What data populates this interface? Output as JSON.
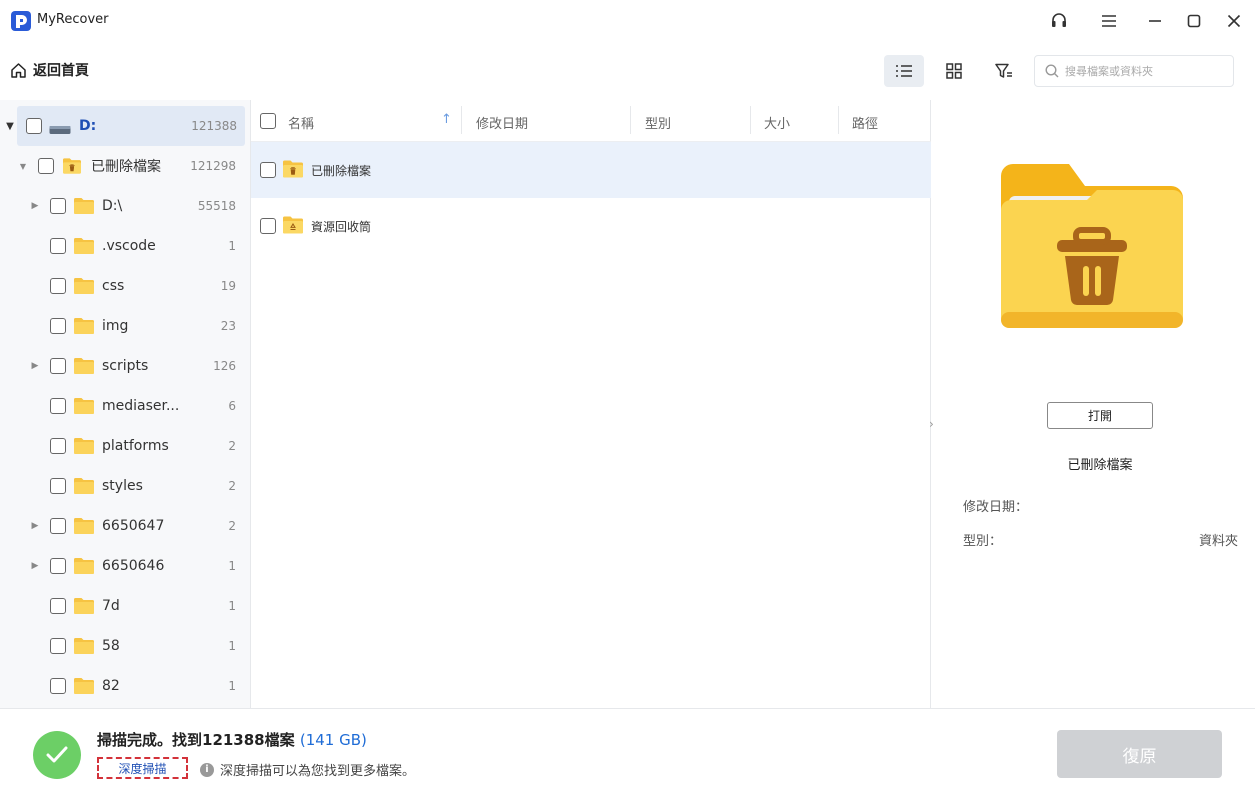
{
  "app": {
    "title": "MyRecover"
  },
  "toolbar": {
    "home_label": "返回首頁",
    "search_placeholder": "搜尋檔案或資料夾"
  },
  "tree": {
    "root": {
      "label": "D:",
      "count": "121388"
    },
    "deleted": {
      "label": "已刪除檔案",
      "count": "121298"
    },
    "items": [
      {
        "label": "D:\\",
        "count": "55518",
        "expandable": true
      },
      {
        "label": ".vscode",
        "count": "1",
        "expandable": false
      },
      {
        "label": "css",
        "count": "19",
        "expandable": false
      },
      {
        "label": "img",
        "count": "23",
        "expandable": false
      },
      {
        "label": "scripts",
        "count": "126",
        "expandable": true
      },
      {
        "label": "mediaser...",
        "count": "6",
        "expandable": false
      },
      {
        "label": "platforms",
        "count": "2",
        "expandable": false
      },
      {
        "label": "styles",
        "count": "2",
        "expandable": false
      },
      {
        "label": "6650647",
        "count": "2",
        "expandable": true
      },
      {
        "label": "6650646",
        "count": "1",
        "expandable": true
      },
      {
        "label": "7d",
        "count": "1",
        "expandable": false
      },
      {
        "label": "58",
        "count": "1",
        "expandable": false
      },
      {
        "label": "82",
        "count": "1",
        "expandable": false
      }
    ]
  },
  "table": {
    "headers": {
      "name": "名稱",
      "modified": "修改日期",
      "type": "型別",
      "size": "大小",
      "path": "路徑"
    },
    "rows": [
      {
        "name": "已刪除檔案"
      },
      {
        "name": "資源回收筒"
      }
    ]
  },
  "details": {
    "open_label": "打開",
    "name": "已刪除檔案",
    "modified_label": "修改日期：",
    "modified_value": "",
    "type_label": "型別：",
    "type_value": "資料夾"
  },
  "footer": {
    "status": "掃描完成。找到121388檔案",
    "size": "(141 GB)",
    "deep_scan_label": "深度掃描",
    "hint": "深度掃描可以為您找到更多檔案。",
    "restore_label": "復原"
  },
  "colors": {
    "accent": "#1f6cd6",
    "success": "#6ccf66",
    "folder": "#fbc02d",
    "selected_row": "#eaf1fb"
  }
}
